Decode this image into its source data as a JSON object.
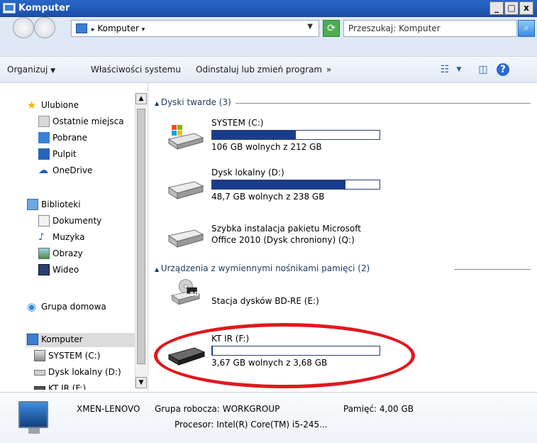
{
  "window": {
    "title": "Komputer",
    "min": "_",
    "max": "□",
    "close": "x"
  },
  "address": {
    "path": "Komputer",
    "search_placeholder": "Przeszukaj: Komputer"
  },
  "toolbar": {
    "organize": "Organizuj",
    "system_properties": "Właściwości systemu",
    "uninstall": "Odinstaluj lub zmień program",
    "more": "»"
  },
  "nav": {
    "favorites": "Ulubione",
    "recent": "Ostatnie miejsca",
    "downloads": "Pobrane",
    "desktop": "Pulpit",
    "onedrive": "OneDrive",
    "libraries": "Biblioteki",
    "documents": "Dokumenty",
    "music": "Muzyka",
    "pictures": "Obrazy",
    "video": "Wideo",
    "homegroup": "Grupa domowa",
    "computer": "Komputer",
    "system_c": "SYSTEM (C:)",
    "local_d": "Dysk lokalny (D:)",
    "ktir_f": "KT IR (F:)"
  },
  "content": {
    "group_hard_disks": "Dyski twarde (3)",
    "group_removable": "Urządzenia z wymiennymi nośnikami pamięci (2)",
    "drives": [
      {
        "name": "SYSTEM (C:)",
        "free": "106 GB wolnych z 212 GB",
        "used_fraction": 0.5
      },
      {
        "name": "Dysk lokalny (D:)",
        "free": "48,7 GB wolnych z 238 GB",
        "used_fraction": 0.795
      },
      {
        "name_line1": "Szybka instalacja pakietu Microsoft",
        "name_line2": "Office 2010 (Dysk chroniony) (Q:)"
      }
    ],
    "removable": [
      {
        "name": "Stacja dysków BD-RE (E:)",
        "badge": "BD"
      },
      {
        "name": "KT IR (F:)",
        "free": "3,67 GB wolnych z 3,68 GB",
        "used_fraction": 0.003
      }
    ]
  },
  "details": {
    "pc_name": "XMEN-LENOVO",
    "workgroup": "Grupa robocza: WORKGROUP",
    "memory": "Pamięć: 4,00 GB",
    "processor": "Procesor: Intel(R) Core(TM) i5-245..."
  },
  "colors": {
    "accent": "#1b3c8c",
    "highlight_ellipse": "#e0181e",
    "titlebar": "#2a67c9"
  }
}
